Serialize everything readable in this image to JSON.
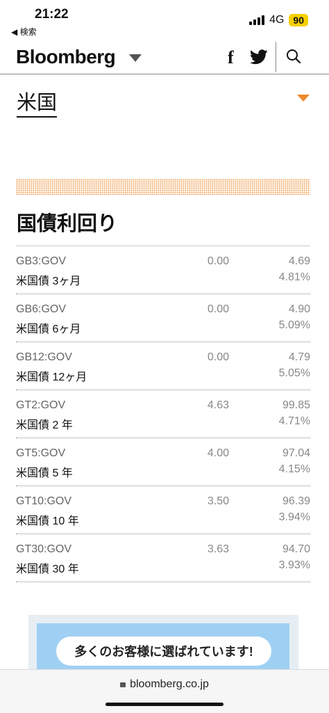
{
  "status": {
    "time": "21:22",
    "back_label": "◀ 検索",
    "network": "4G",
    "battery": "90"
  },
  "header": {
    "logo": "Bloomberg",
    "facebook": "f"
  },
  "region": {
    "label": "米国"
  },
  "section": {
    "title": "国債利回り"
  },
  "bonds": [
    {
      "ticker": "GB3:GOV",
      "name": "米国債 3ヶ月",
      "coupon": "0.00",
      "price": "4.69",
      "yield": "4.81%"
    },
    {
      "ticker": "GB6:GOV",
      "name": "米国債 6ヶ月",
      "coupon": "0.00",
      "price": "4.90",
      "yield": "5.09%"
    },
    {
      "ticker": "GB12:GOV",
      "name": "米国債 12ヶ月",
      "coupon": "0.00",
      "price": "4.79",
      "yield": "5.05%"
    },
    {
      "ticker": "GT2:GOV",
      "name": "米国債 2 年",
      "coupon": "4.63",
      "price": "99.85",
      "yield": "4.71%"
    },
    {
      "ticker": "GT5:GOV",
      "name": "米国債 5 年",
      "coupon": "4.00",
      "price": "97.04",
      "yield": "4.15%"
    },
    {
      "ticker": "GT10:GOV",
      "name": "米国債 10 年",
      "coupon": "3.50",
      "price": "96.39",
      "yield": "3.94%"
    },
    {
      "ticker": "GT30:GOV",
      "name": "米国債 30 年",
      "coupon": "3.63",
      "price": "94.70",
      "yield": "3.93%"
    }
  ],
  "ad": {
    "text": "多くのお客様に選ばれています!"
  },
  "browser": {
    "url": "bloomberg.co.jp"
  },
  "colors": {
    "accent": "#f0882a",
    "muted": "#888888",
    "ad_bg": "#9fd0f4"
  },
  "icons": [
    "back-arrow-icon",
    "signal-icon",
    "battery-icon",
    "logo-caret-icon",
    "facebook-icon",
    "twitter-icon",
    "search-icon",
    "region-caret-icon",
    "lock-icon"
  ]
}
